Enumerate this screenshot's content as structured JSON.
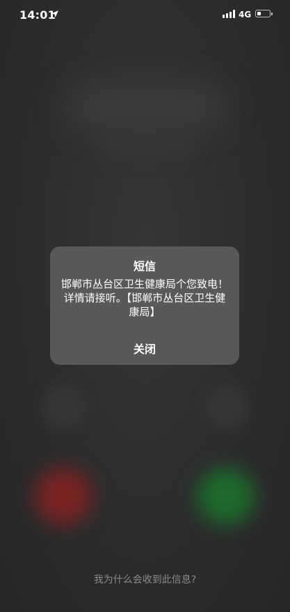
{
  "status_bar": {
    "time": "14:01",
    "network": "4G",
    "battery_level": 0.35,
    "icons": [
      "location-arrow-icon",
      "signal-bars-icon",
      "battery-icon"
    ]
  },
  "alert": {
    "title": "短信",
    "message": "邯郸市丛台区卫生健康局个您致电！详情请接听。【邯郸市丛台区卫生健康局】",
    "close_label": "关闭"
  },
  "call_controls": {
    "decline_color": "#7a2323",
    "accept_color": "#1d6a2c"
  },
  "footer": {
    "why_label": "我为什么会收到此信息?"
  }
}
